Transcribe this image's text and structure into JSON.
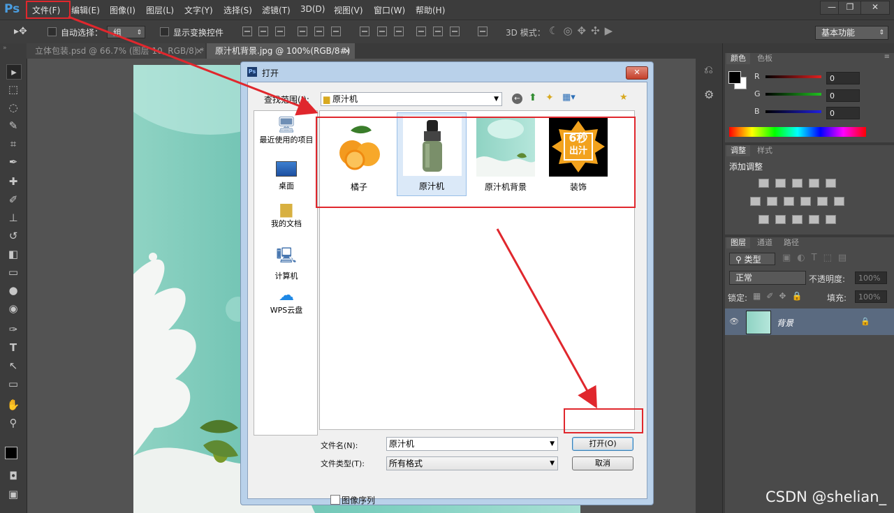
{
  "app": {
    "logo": "Ps",
    "menu": [
      "文件(F)",
      "编辑(E)",
      "图像(I)",
      "图层(L)",
      "文字(Y)",
      "选择(S)",
      "滤镜(T)",
      "3D(D)",
      "视图(V)",
      "窗口(W)",
      "帮助(H)"
    ],
    "window_buttons": [
      "—",
      "❐",
      "✕"
    ]
  },
  "options_bar": {
    "auto_select_label": "自动选择：",
    "auto_select_value": "组",
    "show_transform_label": "显示变换控件",
    "mode_3d_label": "3D 模式：",
    "workspace": "基本功能"
  },
  "doc_tabs": [
    {
      "title": "立体包装.psd @ 66.7% (图层 10, RGB/8) *",
      "close": "×"
    },
    {
      "title": "原汁机背景.jpg @ 100%(RGB/8#)",
      "close": "×"
    }
  ],
  "panels": {
    "color": {
      "tabs": [
        "颜色",
        "色板"
      ],
      "channels": [
        {
          "label": "R",
          "value": "0",
          "color": "#e02020"
        },
        {
          "label": "G",
          "value": "0",
          "color": "#20c020"
        },
        {
          "label": "B",
          "value": "0",
          "color": "#2020e0"
        }
      ]
    },
    "adjust": {
      "tabs": [
        "调整",
        "样式"
      ],
      "title": "添加调整"
    },
    "layers": {
      "tabs": [
        "图层",
        "通道",
        "路径"
      ],
      "filter_label": "类型",
      "blend_mode": "正常",
      "opacity_label": "不透明度:",
      "opacity_value": "100%",
      "lock_label": "锁定:",
      "fill_label": "填充:",
      "fill_value": "100%",
      "layer_name": "背景"
    }
  },
  "dialog": {
    "title": "打开",
    "close": "✕",
    "look_in_label": "查找范围(I):",
    "look_in_value": "原汁机",
    "places": [
      "最近使用的项目",
      "桌面",
      "我的文档",
      "计算机",
      "WPS云盘"
    ],
    "files": [
      {
        "name": "橘子",
        "selected": false
      },
      {
        "name": "原汁机",
        "selected": true
      },
      {
        "name": "原汁机背景",
        "selected": false
      },
      {
        "name": "装饰",
        "selected": false
      }
    ],
    "decor_badge": {
      "line1": "6秒",
      "line2": "出汁"
    },
    "filename_label": "文件名(N):",
    "filename_value": "原汁机",
    "filetype_label": "文件类型(T):",
    "filetype_value": "所有格式",
    "open_button": "打开(O)",
    "cancel_button": "取消",
    "image_sequence": "图像序列"
  },
  "watermark": "CSDN @shelian_",
  "accent_color": "#e0272d"
}
